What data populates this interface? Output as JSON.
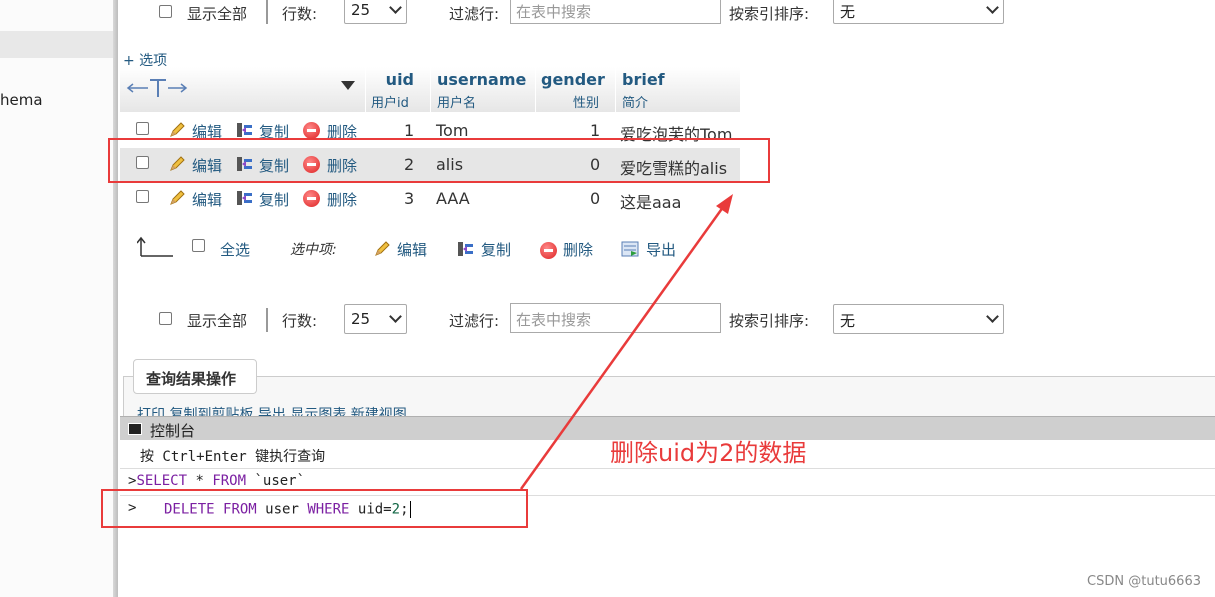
{
  "left_pane": {
    "item": "hema"
  },
  "controls": {
    "show_all": "显示全部",
    "rows_label": "行数:",
    "rows_value": "25",
    "filter_label": "过滤行:",
    "filter_placeholder": "在表中搜索",
    "sort_label": "按索引排序:",
    "sort_value": "无"
  },
  "options_link": "+ 选项",
  "table": {
    "columns": [
      {
        "name": "uid",
        "comment": "用户id"
      },
      {
        "name": "username",
        "comment": "用户名"
      },
      {
        "name": "gender",
        "comment": "性别"
      },
      {
        "name": "brief",
        "comment": "简介"
      }
    ],
    "actions": {
      "edit": "编辑",
      "copy": "复制",
      "delete": "删除"
    },
    "rows": [
      {
        "uid": "1",
        "username": "Tom",
        "gender": "1",
        "brief": "爱吃泡芙的Tom"
      },
      {
        "uid": "2",
        "username": "alis",
        "gender": "0",
        "brief": "爱吃雪糕的alis"
      },
      {
        "uid": "3",
        "username": "AAA",
        "gender": "0",
        "brief": "这是aaa"
      }
    ]
  },
  "bulk": {
    "select_all": "全选",
    "with_selected": "选中项:",
    "edit": "编辑",
    "copy": "复制",
    "delete": "删除",
    "export": "导出"
  },
  "query_ops": {
    "tab": "查询结果操作",
    "items": "打印 复制到剪贴板 导出 显示图表 新建视图"
  },
  "console": {
    "title": "控制台",
    "hint": "按 Ctrl+Enter 键执行查询",
    "line1": {
      "prompt": ">",
      "kw1": "SELECT",
      "star": " * ",
      "kw2": "FROM",
      "rest": " `user`"
    },
    "line2": {
      "prompt": ">",
      "kw1": "DELETE",
      "kw2": "FROM",
      "table": " user ",
      "kw3": "WHERE",
      "cond": " uid=",
      "num": "2",
      "end": ";"
    }
  },
  "annotation": "删除uid为2的数据",
  "watermark": "CSDN @tutu6663",
  "colors": {
    "accent": "#235a81",
    "annotation": "#e93b3b"
  }
}
